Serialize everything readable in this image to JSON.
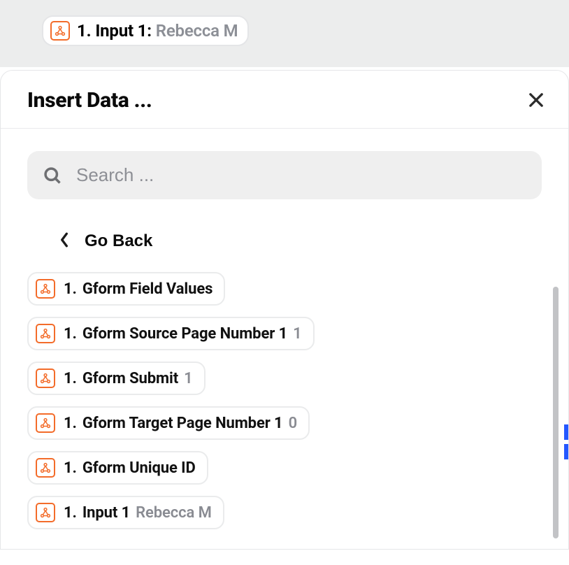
{
  "topPill": {
    "prefix": "1.",
    "label": "Input 1:",
    "value": "Rebecca M"
  },
  "panel": {
    "title": "Insert Data ..."
  },
  "search": {
    "placeholder": "Search ..."
  },
  "goBack": {
    "label": "Go Back"
  },
  "fields": [
    {
      "prefix": "1.",
      "label": "Gform Field Values",
      "value": ""
    },
    {
      "prefix": "1.",
      "label": "Gform Source Page Number 1",
      "value": "1"
    },
    {
      "prefix": "1.",
      "label": "Gform Submit",
      "value": "1"
    },
    {
      "prefix": "1.",
      "label": "Gform Target Page Number 1",
      "value": "0"
    },
    {
      "prefix": "1.",
      "label": "Gform Unique ID",
      "value": ""
    },
    {
      "prefix": "1.",
      "label": "Input 1",
      "value": "Rebecca M"
    }
  ]
}
